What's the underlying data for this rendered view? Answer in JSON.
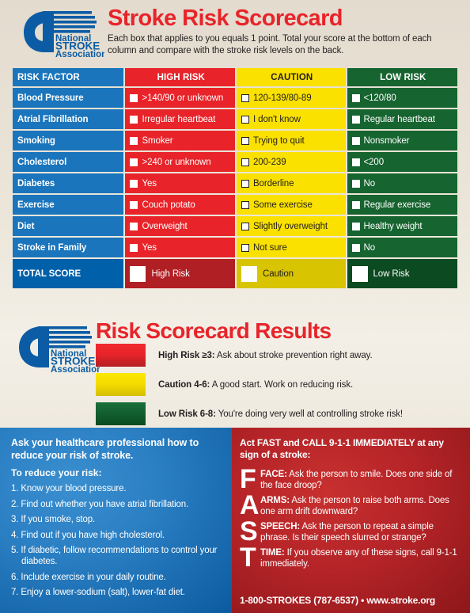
{
  "header": {
    "title": "Stroke Risk Scorecard",
    "subtitle": "Each box that applies to you equals 1 point. Total your score at the bottom of each column and compare with the stroke risk levels on the back.",
    "logo_line1": "National",
    "logo_line2": "STROKE",
    "logo_line3": "Association",
    "logo_tm": "™"
  },
  "scorecard": {
    "columns": [
      "RISK FACTOR",
      "HIGH RISK",
      "CAUTION",
      "LOW RISK"
    ],
    "rows": [
      {
        "factor": "Blood Pressure",
        "high": ">140/90 or unknown",
        "caution": "120-139/80-89",
        "low": "<120/80"
      },
      {
        "factor": "Atrial Fibrillation",
        "high": "Irregular heartbeat",
        "caution": "I don't know",
        "low": "Regular heartbeat"
      },
      {
        "factor": "Smoking",
        "high": "Smoker",
        "caution": "Trying to quit",
        "low": "Nonsmoker"
      },
      {
        "factor": "Cholesterol",
        "high": ">240 or unknown",
        "caution": "200-239",
        "low": "<200"
      },
      {
        "factor": "Diabetes",
        "high": "Yes",
        "caution": "Borderline",
        "low": "No"
      },
      {
        "factor": "Exercise",
        "high": "Couch potato",
        "caution": "Some exercise",
        "low": "Regular exercise"
      },
      {
        "factor": "Diet",
        "high": "Overweight",
        "caution": "Slightly overweight",
        "low": "Healthy weight"
      },
      {
        "factor": "Stroke in Family",
        "high": "Yes",
        "caution": "Not sure",
        "low": "No"
      }
    ],
    "total": {
      "factor": "TOTAL SCORE",
      "high": "High Risk",
      "caution": "Caution",
      "low": "Low Risk"
    },
    "colors": {
      "factor": "#1a75bc",
      "high": "#e8242a",
      "caution": "#fae100",
      "low": "#16642f"
    }
  },
  "results": {
    "title": "Risk Scorecard Results",
    "items": [
      {
        "swatch": "red",
        "label": "High Risk ≥3:",
        "text": " Ask about stroke prevention right away."
      },
      {
        "swatch": "yellow",
        "label": "Caution 4-6:",
        "text": " A good start. Work on reducing risk."
      },
      {
        "swatch": "green",
        "label": "Low Risk 6-8:",
        "text": " You're doing very well at controlling stroke risk!"
      }
    ]
  },
  "bottom": {
    "blue": {
      "heading": "Ask your healthcare professional how to reduce your risk of stroke.",
      "subheading": "To reduce your risk:",
      "items": [
        "1. Know your blood pressure.",
        "2. Find out whether you have atrial fibrillation.",
        "3. If you smoke, stop.",
        "4. Find out if you have high cholesterol.",
        "5. If diabetic, follow recommendations to control your diabetes.",
        "6. Include exercise in your daily routine.",
        "7. Enjoy a lower-sodium (salt), lower-fat diet."
      ]
    },
    "red": {
      "heading": "Act FAST and CALL 9-1-1 IMMEDIATELY at any sign of a stroke:",
      "fast": [
        {
          "letter": "F",
          "label": "FACE:",
          "text": " Ask the person to smile. Does one side of the face droop?"
        },
        {
          "letter": "A",
          "label": "ARMS:",
          "text": " Ask the person to raise both arms. Does one arm drift downward?"
        },
        {
          "letter": "S",
          "label": "SPEECH:",
          "text": " Ask the person to repeat a simple phrase. Is their speech slurred or strange?"
        },
        {
          "letter": "T",
          "label": "TIME:",
          "text": " If you observe any of these signs, call 9-1-1 immediately."
        }
      ],
      "footer": "1-800-STROKES (787-6537) • www.stroke.org"
    }
  }
}
